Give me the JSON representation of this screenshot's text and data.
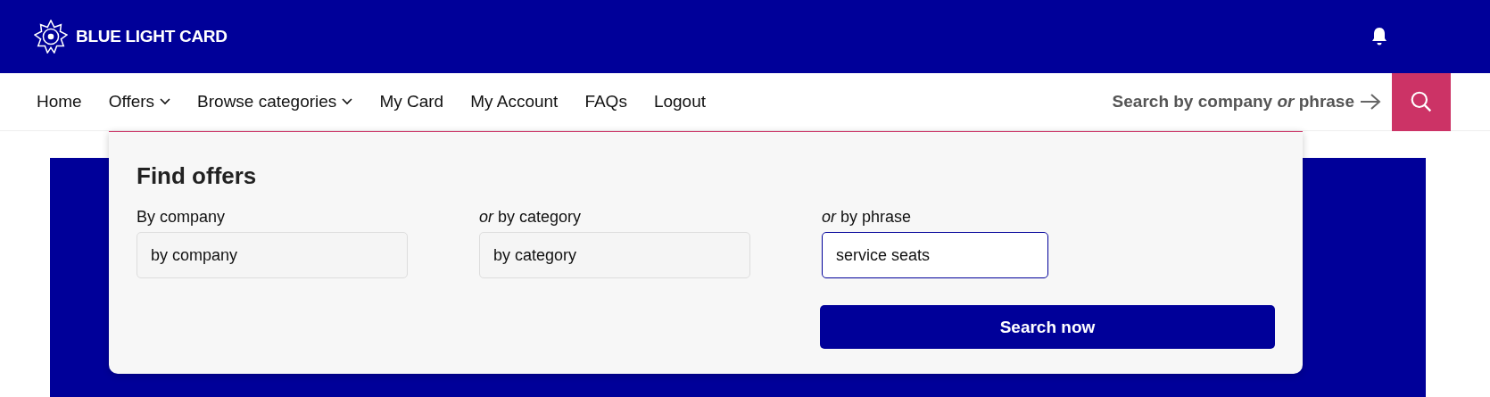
{
  "header": {
    "brand": "BLUE LIGHT CARD"
  },
  "nav": {
    "items": [
      {
        "label": "Home",
        "kind": "link"
      },
      {
        "label": "Offers",
        "kind": "dropdown"
      },
      {
        "label": "Browse categories",
        "kind": "dropdown"
      },
      {
        "label": "My Card",
        "kind": "link"
      },
      {
        "label": "My Account",
        "kind": "link"
      },
      {
        "label": "FAQs",
        "kind": "link"
      },
      {
        "label": "Logout",
        "kind": "link"
      }
    ],
    "search_prompt": "Search by company *or* phrase"
  },
  "find_offers": {
    "title": "Find offers",
    "filters": [
      {
        "label": "By company",
        "placeholder": "by company",
        "focused": false
      },
      {
        "label": "*or* by category",
        "placeholder": "by category",
        "focused": false
      },
      {
        "label": "*or* by phrase",
        "value": "service seats",
        "focused": true
      }
    ],
    "button": "Search now"
  }
}
